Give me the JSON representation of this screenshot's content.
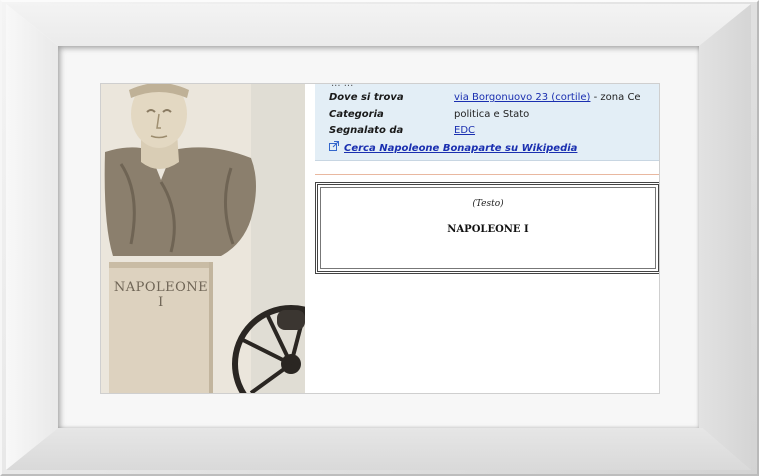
{
  "photo": {
    "inscription": "NAPOLEONE I"
  },
  "info": {
    "cut_row_text": "... ...",
    "location": {
      "label": "Dove si trova",
      "link": "via Borgonuovo 23 (cortile)",
      "suffix": " - zona Ce"
    },
    "category": {
      "label": "Categoria",
      "value": "politica e Stato"
    },
    "reporter": {
      "label": "Segnalato da",
      "link": "EDC"
    },
    "wikipedia_link": "Cerca Napoleone Bonaparte su Wikipedia",
    "external_link_icon": "external-link-icon"
  },
  "text_panel": {
    "caption": "(Testo)",
    "inscription": "NAPOLEONE I"
  },
  "colors": {
    "info_background": "#e3eef6",
    "link": "#1a2fb0",
    "separator": "#e9b8a0"
  }
}
